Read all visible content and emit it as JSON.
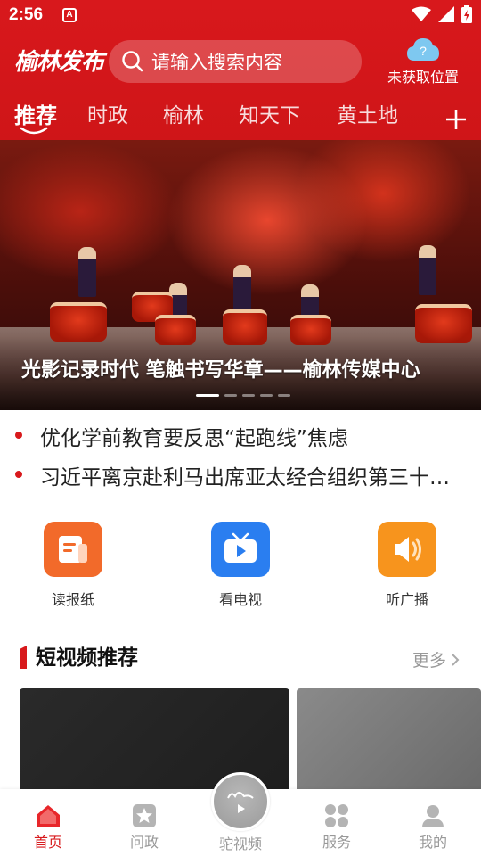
{
  "status_bar": {
    "time": "2:56",
    "notification_badge": "A"
  },
  "header": {
    "logo_text": "榆林发布",
    "search_placeholder": "请输入搜索内容",
    "location_label": "未获取位置"
  },
  "tabs": [
    {
      "label": "推荐",
      "active": true
    },
    {
      "label": "时政",
      "active": false
    },
    {
      "label": "榆林",
      "active": false
    },
    {
      "label": "知天下",
      "active": false
    },
    {
      "label": "黄土地",
      "active": false
    }
  ],
  "banner": {
    "title": "光影记录时代 笔触书写华章——榆林传媒中心",
    "slide_count": 5,
    "active_slide": 1
  },
  "headlines": [
    "优化学前教育要反思“起跑线”焦虑",
    "习近平离京赴利马出席亚太经合组织第三十一次领导人非正式会议"
  ],
  "shortcuts": [
    {
      "label": "读报纸",
      "icon": "newspaper-icon",
      "color": "#f26a2a"
    },
    {
      "label": "看电视",
      "icon": "tv-icon",
      "color": "#2a7ef0"
    },
    {
      "label": "听广播",
      "icon": "speaker-icon",
      "color": "#f7941d"
    }
  ],
  "short_video_section": {
    "title": "短视频推荐",
    "more_label": "更多"
  },
  "bottom_nav": [
    {
      "label": "首页",
      "icon": "home-icon",
      "active": true
    },
    {
      "label": "问政",
      "icon": "star-icon",
      "active": false
    },
    {
      "label": "驼视频",
      "icon": "camel-video-icon",
      "active": false
    },
    {
      "label": "服务",
      "icon": "grid-icon",
      "active": false
    },
    {
      "label": "我的",
      "icon": "person-icon",
      "active": false
    }
  ],
  "colors": {
    "brand_red": "#d8191c"
  }
}
